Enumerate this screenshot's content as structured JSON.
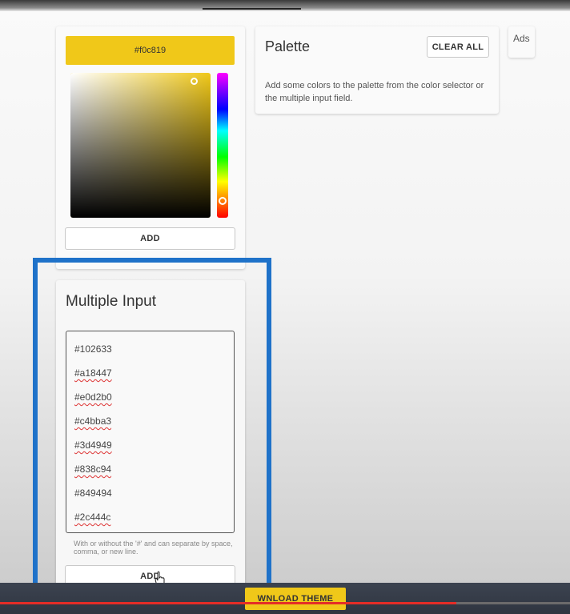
{
  "picker": {
    "hex_value": "#f0c819",
    "selected_color": "#f0c819",
    "hue_color": "#f0c819",
    "add_label": "ADD"
  },
  "palette": {
    "title": "Palette",
    "clear_label": "CLEAR ALL",
    "hint": "Add some colors to the palette from the color selector or the multiple input field."
  },
  "ads": {
    "label": "Ads"
  },
  "multiple_input": {
    "title": "Multiple Input",
    "lines": [
      "#102633",
      "#a18447",
      "#e0d2b0",
      "#c4bba3",
      "#3d4949",
      "#838c94",
      "#849494",
      "#2c444c"
    ],
    "hint": "With or without the '#' and can separate by space, comma, or new line.",
    "add_label": "ADD"
  },
  "download": {
    "label": "DOWNLOAD THEME",
    "visible_label": "WNLOAD THEME"
  },
  "colors": {
    "accent": "#f0c819",
    "highlight": "#1f72c9",
    "progress": "#e52d27"
  },
  "video_progress": 0.8
}
